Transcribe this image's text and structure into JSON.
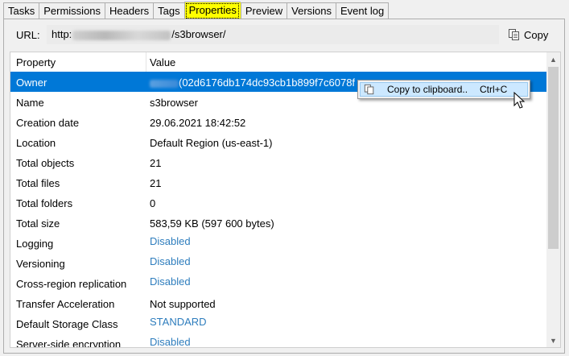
{
  "tabs": [
    {
      "label": "Tasks"
    },
    {
      "label": "Permissions"
    },
    {
      "label": "Headers"
    },
    {
      "label": "Tags"
    },
    {
      "label": "Properties"
    },
    {
      "label": "Preview"
    },
    {
      "label": "Versions"
    },
    {
      "label": "Event log"
    }
  ],
  "active_tab": "Properties",
  "url_bar": {
    "label": "URL:",
    "value_prefix": "http:",
    "value_suffix": "/s3browser/",
    "copy_label": "Copy",
    "copy_icon": "copy-icon"
  },
  "table": {
    "columns": [
      "Property",
      "Value"
    ],
    "rows": [
      {
        "property": "Owner",
        "value": "(02d6176db174dc93cb1b899f7c6078f",
        "type": "text",
        "selected": true
      },
      {
        "property": "Name",
        "value": "s3browser",
        "type": "text"
      },
      {
        "property": "Creation date",
        "value": "29.06.2021 18:42:52",
        "type": "text"
      },
      {
        "property": "Location",
        "value": "Default Region (us-east-1)",
        "type": "text"
      },
      {
        "property": "Total objects",
        "value": "21",
        "type": "text"
      },
      {
        "property": "Total files",
        "value": "21",
        "type": "text"
      },
      {
        "property": "Total folders",
        "value": "0",
        "type": "text"
      },
      {
        "property": "Total size",
        "value": "583,59 KB (597 600 bytes)",
        "type": "text"
      },
      {
        "property": "Logging",
        "value": "Disabled",
        "type": "link"
      },
      {
        "property": "Versioning",
        "value": "Disabled",
        "type": "link"
      },
      {
        "property": "Cross-region replication",
        "value": "Disabled",
        "type": "link"
      },
      {
        "property": "Transfer Acceleration",
        "value": "Not supported",
        "type": "text"
      },
      {
        "property": "Default Storage Class",
        "value": "STANDARD",
        "type": "link"
      },
      {
        "property": "Server-side encryption",
        "value": "Disabled",
        "type": "link"
      }
    ]
  },
  "context_menu": {
    "items": [
      {
        "label": "Copy to clipboard..",
        "shortcut": "Ctrl+C",
        "icon": "copy-icon"
      }
    ]
  },
  "colors": {
    "selection": "#0078d7",
    "link": "#2e7dbd",
    "active_tab": "#ffff00",
    "menu_highlight": "#cce8ff"
  }
}
